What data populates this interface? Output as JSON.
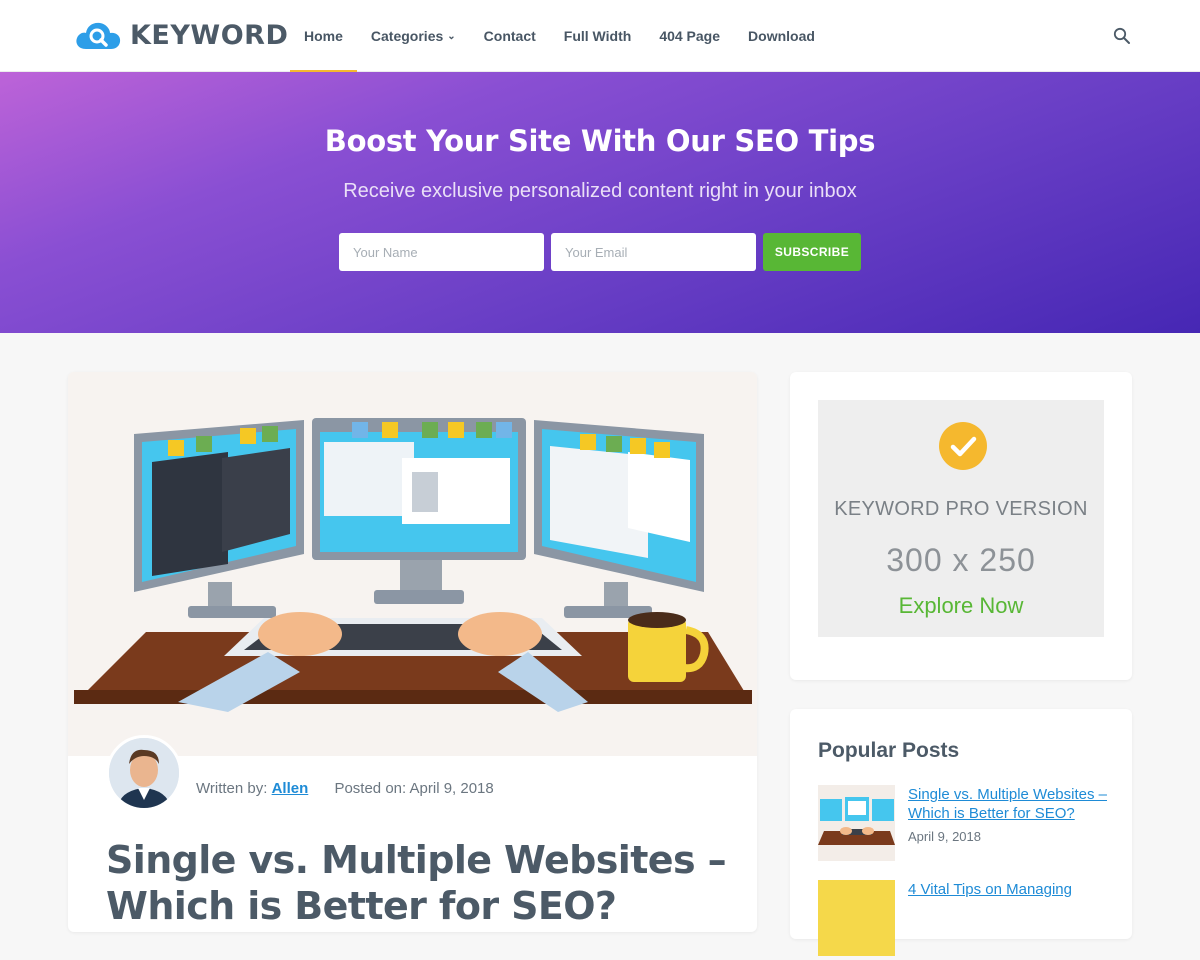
{
  "header": {
    "logo_text": "KEYWORD",
    "nav": [
      {
        "label": "Home",
        "active": true
      },
      {
        "label": "Categories",
        "has_dropdown": true
      },
      {
        "label": "Contact"
      },
      {
        "label": "Full Width"
      },
      {
        "label": "404 Page"
      },
      {
        "label": "Download"
      }
    ],
    "search_icon": "search-icon"
  },
  "hero": {
    "title": "Boost Your Site With Our SEO Tips",
    "subtitle": "Receive exclusive personalized content right in your inbox",
    "name_placeholder": "Your Name",
    "email_placeholder": "Your Email",
    "subscribe_label": "SUBSCRIBE"
  },
  "post": {
    "written_by_label": "Written by:",
    "author": "Allen",
    "posted_on_label": "Posted on:",
    "date": "April 9, 2018",
    "title": "Single vs. Multiple Websites – Which is Better for SEO?"
  },
  "sidebar": {
    "ad": {
      "title": "KEYWORD PRO VERSION",
      "size": "300 x 250",
      "cta": "Explore Now"
    },
    "popular": {
      "heading": "Popular Posts",
      "items": [
        {
          "title": "Single vs. Multiple Websites – Which is Better for SEO?",
          "date": "April 9, 2018"
        },
        {
          "title": "4 Vital Tips on Managing",
          "date": ""
        }
      ]
    }
  },
  "colors": {
    "accent": "#f5b82e",
    "subscribe": "#58b735",
    "link": "#1e8bd6",
    "hero_start": "#bd63d8",
    "hero_end": "#4627b4"
  }
}
